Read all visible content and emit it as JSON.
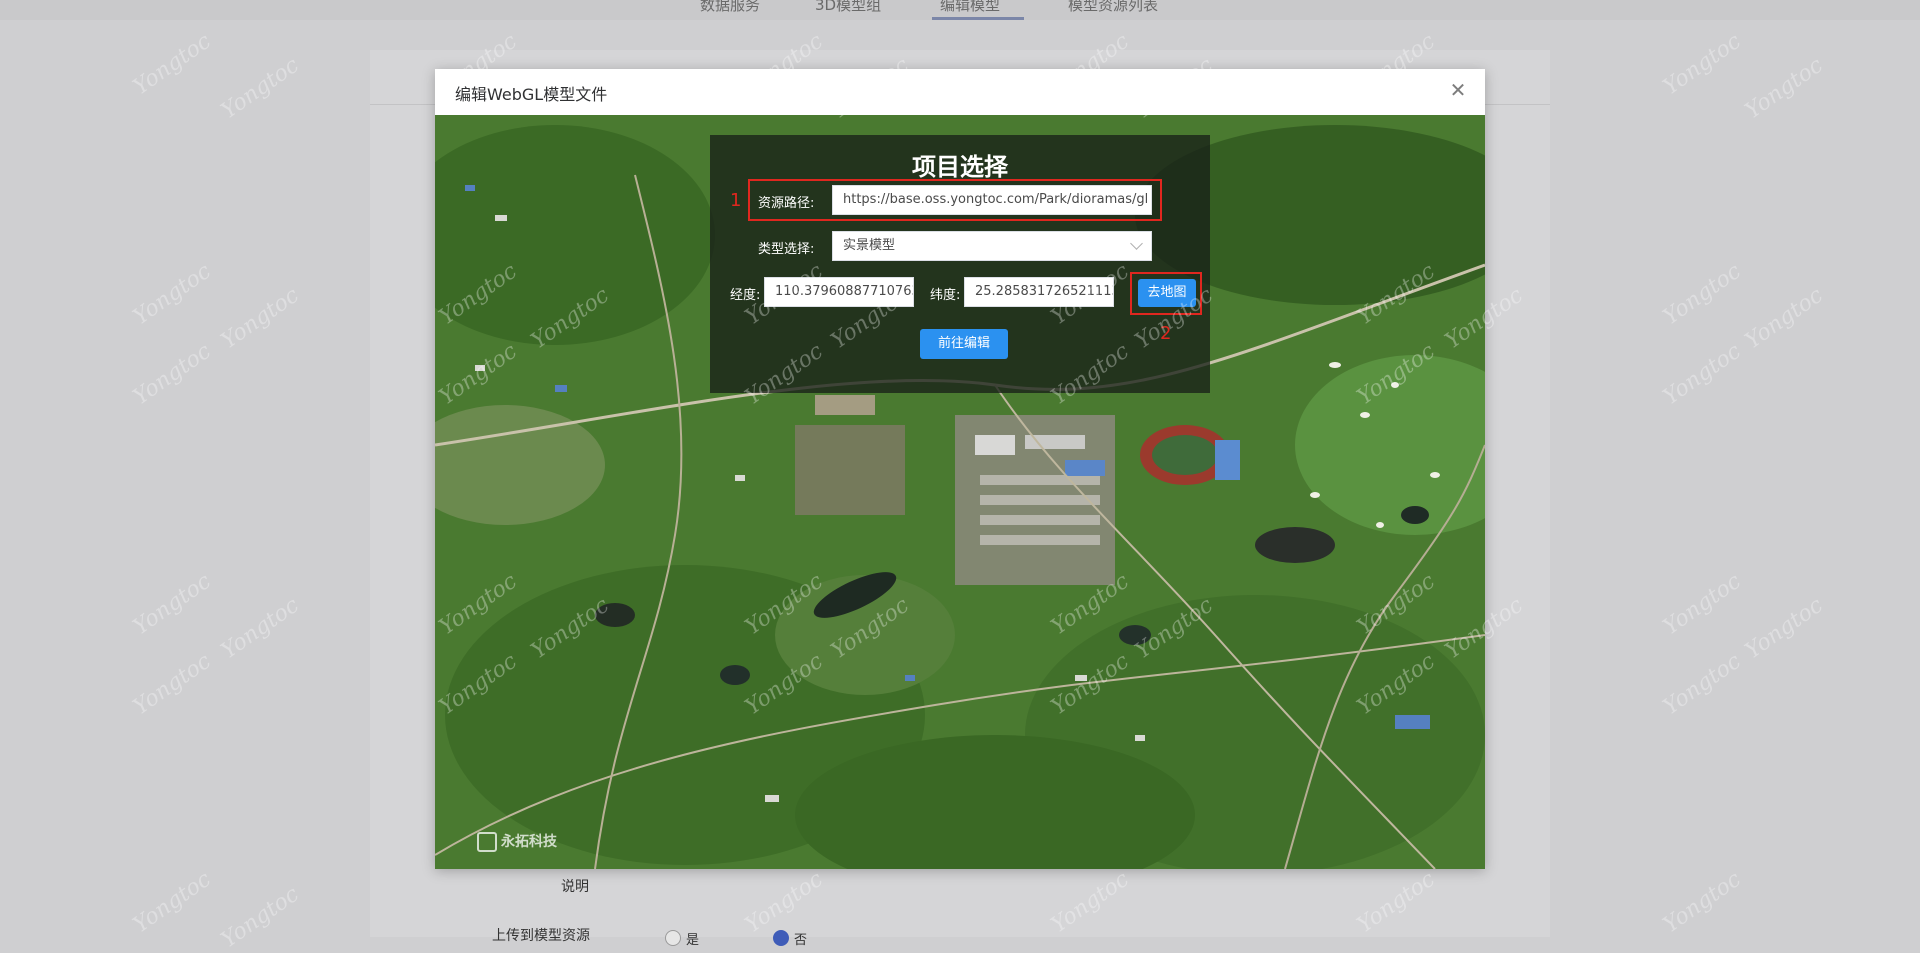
{
  "background": {
    "tabs": [
      "数据服务",
      "3D模型组",
      "编辑模型",
      "模型资源列表"
    ],
    "form_labels": {
      "description": "说明",
      "upload": "上传到模型资源"
    },
    "radio_options": [
      "是",
      "否"
    ]
  },
  "modal": {
    "title": "编辑WebGL模型文件",
    "close_icon": "close-icon"
  },
  "panel": {
    "title": "项目选择",
    "resource_path_label": "资源路径:",
    "resource_path_value": "https://base.oss.yongtoc.com/Park/dioramas/gl",
    "type_label": "类型选择:",
    "type_value": "实景模型",
    "longitude_label": "经度:",
    "longitude_value": "110.37960887710763",
    "latitude_label": "纬度:",
    "latitude_value": "25.285831726521113",
    "go_map_label": "去地图",
    "go_edit_label": "前往编辑"
  },
  "annotations": [
    "1",
    "2"
  ],
  "map_logo": "永拓科技",
  "watermark_text": "Yongtoc",
  "colors": {
    "accent": "#2b91f0",
    "annotation": "#e0271f",
    "overlay": "#cfcfd1"
  }
}
